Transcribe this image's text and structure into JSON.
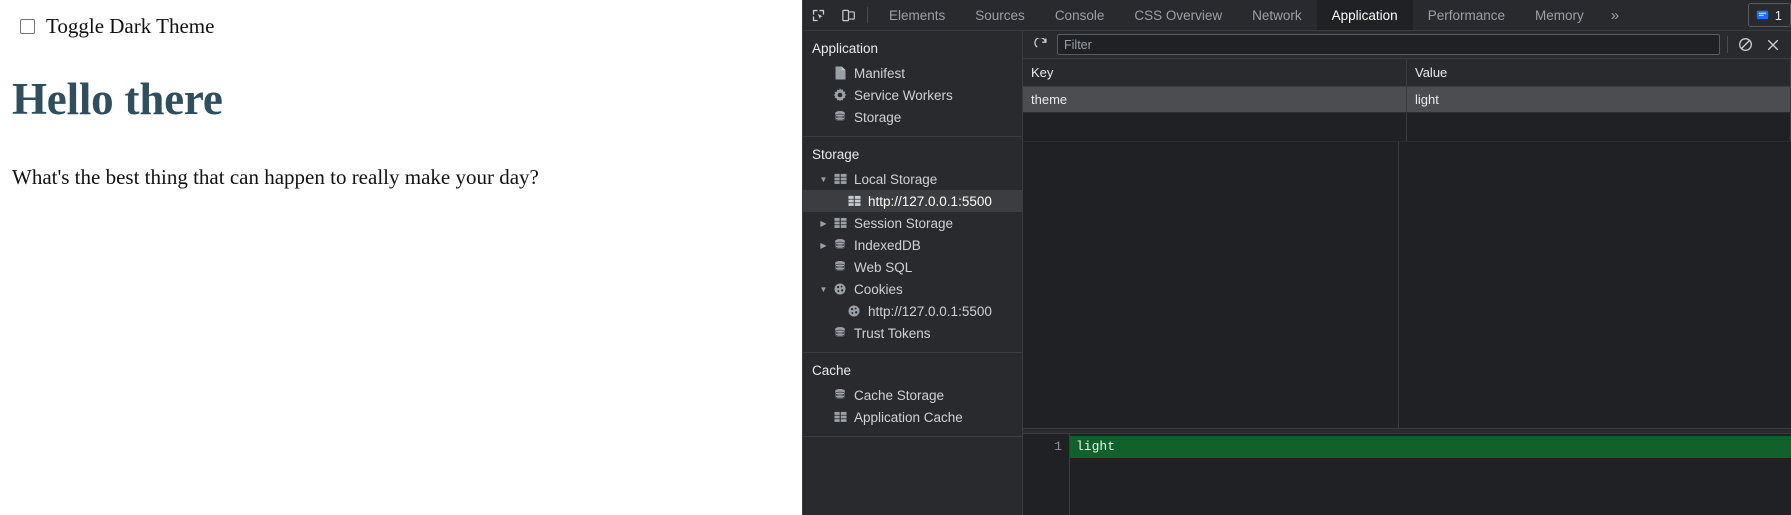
{
  "webpage": {
    "checkbox_label": "Toggle Dark Theme",
    "checkbox_checked": false,
    "heading": "Hello there",
    "paragraph": "What's the best thing that can happen to really make your day?",
    "heading_color": "#2f4f5e"
  },
  "devtools": {
    "toolbar_icons": {
      "inspect": "inspect-element-icon",
      "device": "device-toolbar-icon"
    },
    "tabs": [
      {
        "label": "Elements",
        "active": false
      },
      {
        "label": "Sources",
        "active": false
      },
      {
        "label": "Console",
        "active": false
      },
      {
        "label": "CSS Overview",
        "active": false
      },
      {
        "label": "Network",
        "active": false
      },
      {
        "label": "Application",
        "active": true
      },
      {
        "label": "Performance",
        "active": false
      },
      {
        "label": "Memory",
        "active": false
      }
    ],
    "more_tabs_label": "»",
    "message_count": "1",
    "message_icon": "console-message-icon",
    "accent_blue": "#1a73e8",
    "sidebar": {
      "groups": [
        {
          "title": "Application",
          "items": [
            {
              "label": "Manifest",
              "icon": "document-icon",
              "indent": 1,
              "twisty": "",
              "selected": false
            },
            {
              "label": "Service Workers",
              "icon": "gear-icon",
              "indent": 1,
              "twisty": "",
              "selected": false
            },
            {
              "label": "Storage",
              "icon": "database-icon",
              "indent": 1,
              "twisty": "",
              "selected": false
            }
          ]
        },
        {
          "title": "Storage",
          "items": [
            {
              "label": "Local Storage",
              "icon": "table-icon",
              "indent": 1,
              "twisty": "expanded",
              "selected": false
            },
            {
              "label": "http://127.0.0.1:5500",
              "icon": "table-icon",
              "indent": 2,
              "twisty": "",
              "selected": true
            },
            {
              "label": "Session Storage",
              "icon": "table-icon",
              "indent": 1,
              "twisty": "collapsed",
              "selected": false
            },
            {
              "label": "IndexedDB",
              "icon": "database-icon",
              "indent": 1,
              "twisty": "collapsed",
              "selected": false
            },
            {
              "label": "Web SQL",
              "icon": "database-icon",
              "indent": 1,
              "twisty": "",
              "selected": false
            },
            {
              "label": "Cookies",
              "icon": "cookie-icon",
              "indent": 1,
              "twisty": "expanded",
              "selected": false
            },
            {
              "label": "http://127.0.0.1:5500",
              "icon": "cookie-icon",
              "indent": 2,
              "twisty": "",
              "selected": false
            },
            {
              "label": "Trust Tokens",
              "icon": "database-icon",
              "indent": 1,
              "twisty": "",
              "selected": false
            }
          ]
        },
        {
          "title": "Cache",
          "items": [
            {
              "label": "Cache Storage",
              "icon": "database-icon",
              "indent": 1,
              "twisty": "",
              "selected": false
            },
            {
              "label": "Application Cache",
              "icon": "table-icon",
              "indent": 1,
              "twisty": "",
              "selected": false
            }
          ]
        }
      ]
    },
    "filterbar": {
      "refresh_icon": "refresh-icon",
      "filter_placeholder": "Filter",
      "filter_value": "",
      "clear_all_icon": "clear-all-icon",
      "delete_selected_icon": "delete-selected-icon"
    },
    "storage_table": {
      "columns": [
        "Key",
        "Value"
      ],
      "rows": [
        {
          "key": "theme",
          "value": "light",
          "selected": true
        }
      ]
    },
    "preview": {
      "line_number": "1",
      "content": "light",
      "highlight_color": "#10612b"
    }
  }
}
